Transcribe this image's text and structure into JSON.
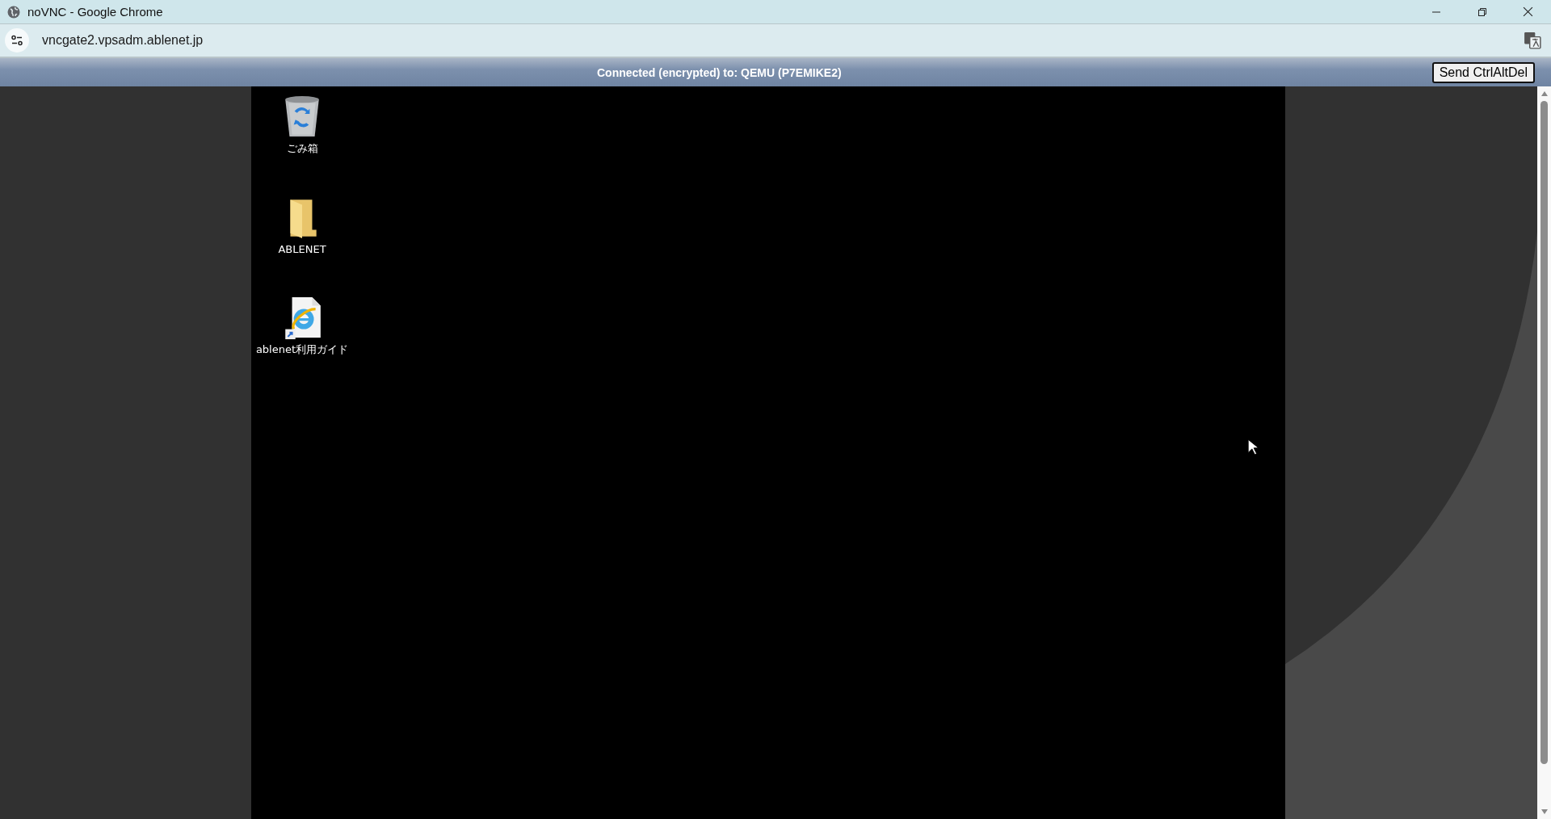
{
  "window": {
    "title": "noVNC - Google Chrome"
  },
  "address_bar": {
    "url": "vncgate2.vpsadm.ablenet.jp"
  },
  "novnc_bar": {
    "status": "Connected (encrypted) to: QEMU (P7EMIKE2)",
    "buttons": [
      "Send CtrlAltDel"
    ]
  },
  "desktop": {
    "icons": [
      {
        "kind": "recycle-bin",
        "label": "ごみ箱"
      },
      {
        "kind": "folder",
        "label": "ABLENET"
      },
      {
        "kind": "shortcut",
        "label": "ablenet利用ガイド"
      }
    ]
  }
}
